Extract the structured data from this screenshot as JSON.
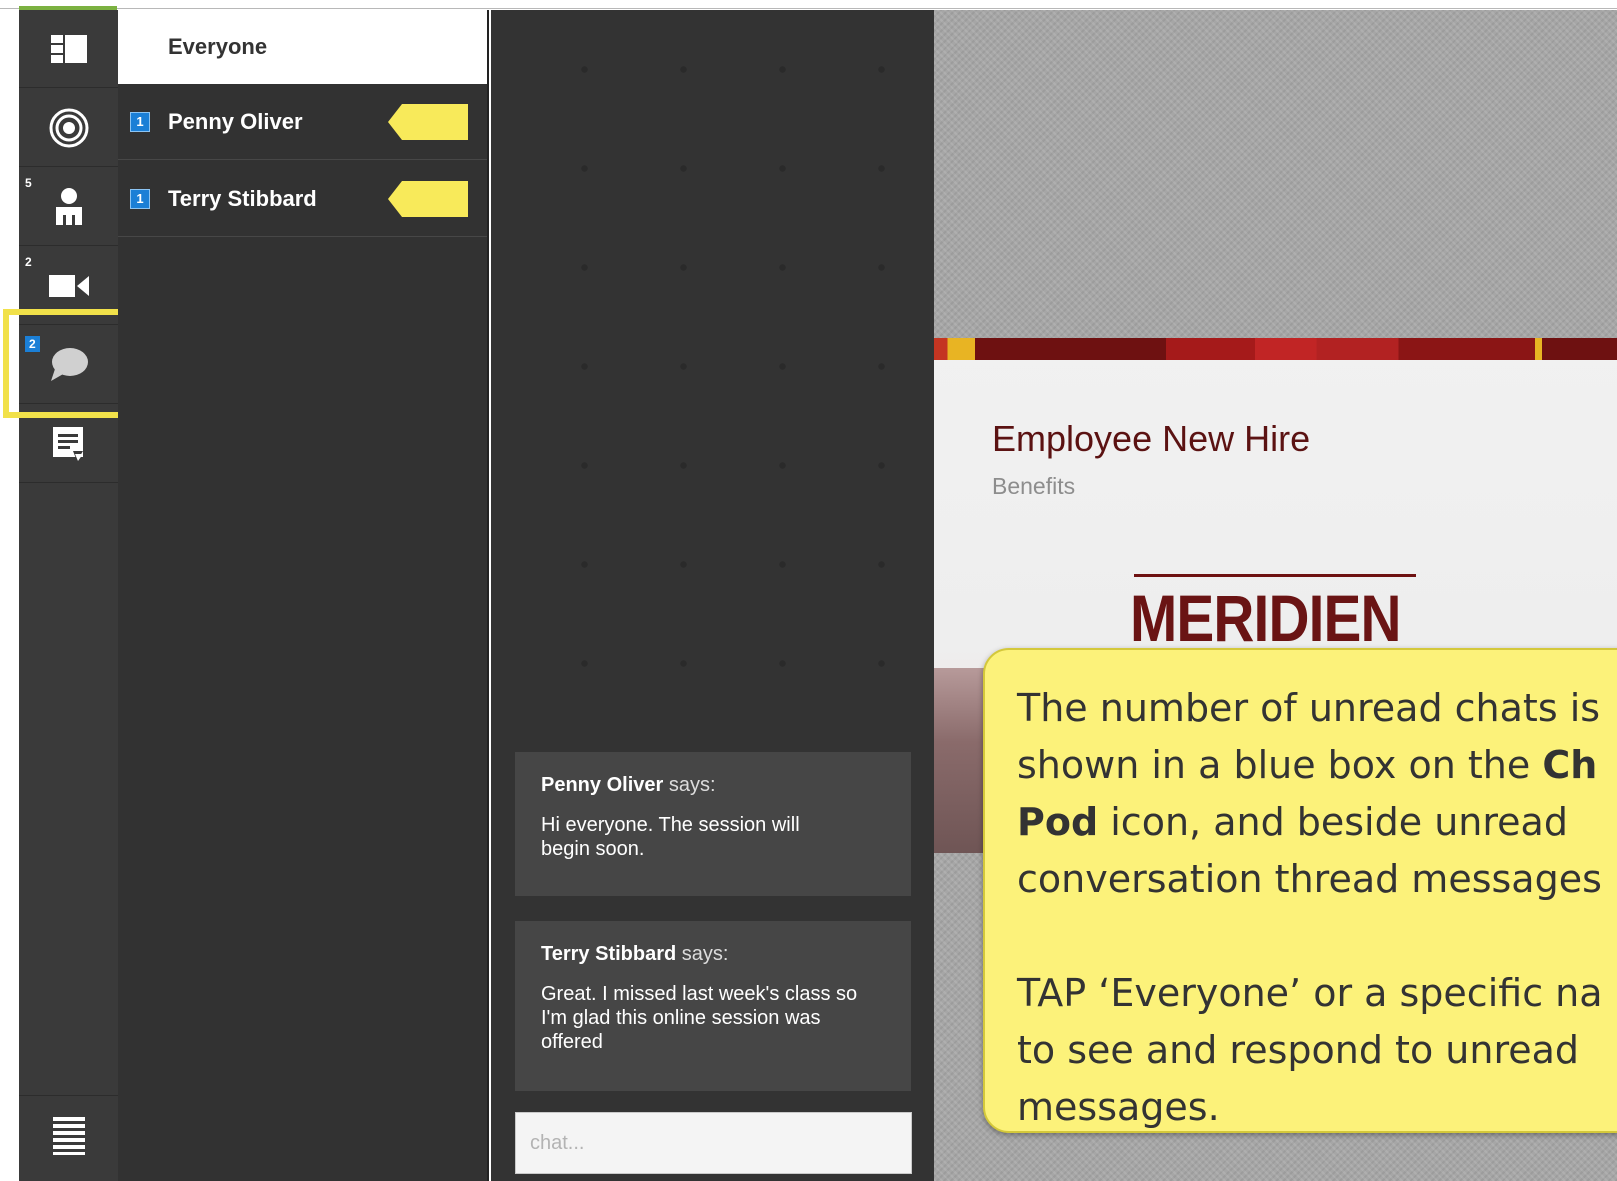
{
  "rail": {
    "items": [
      {
        "name": "layout-icon",
        "count": ""
      },
      {
        "name": "target-icon",
        "count": ""
      },
      {
        "name": "attendees-icon",
        "count": "5"
      },
      {
        "name": "video-icon",
        "count": "2"
      },
      {
        "name": "chat-icon",
        "count": "2"
      },
      {
        "name": "notes-icon",
        "count": ""
      }
    ],
    "bottom": "menu-icon"
  },
  "conversations": {
    "everyone_label": "Everyone",
    "threads": [
      {
        "unread": "1",
        "name": "Penny Oliver"
      },
      {
        "unread": "1",
        "name": "Terry Stibbard"
      }
    ]
  },
  "chat": {
    "messages": [
      {
        "sender": "Penny Oliver",
        "says": " says:",
        "text": "Hi everyone. The session will begin soon."
      },
      {
        "sender": "Terry Stibbard",
        "says": " says:",
        "text": "Great. I missed last week's class so I'm glad this online session was offered"
      }
    ],
    "input_placeholder": "chat..."
  },
  "slide": {
    "title": "Employee New Hire",
    "subtitle": "Benefits",
    "logo_text": "MERIDIEN"
  },
  "callout": {
    "line1": "The number of unread chats is",
    "line2_pre": "shown in a blue box on the ",
    "line2_bold": "Ch",
    "line3_bold": "Pod",
    "line3_post": " icon, and beside unread",
    "line4": "conversation thread messages",
    "line5": "TAP ‘Everyone’ or a specific na",
    "line6": "to see and respond to unread",
    "line7": "messages."
  },
  "colors": {
    "badge_blue": "#1b7fd6",
    "highlight_yellow": "#f1e14a",
    "callout_yellow": "#fcf27a",
    "brand_maroon": "#6a1414"
  }
}
